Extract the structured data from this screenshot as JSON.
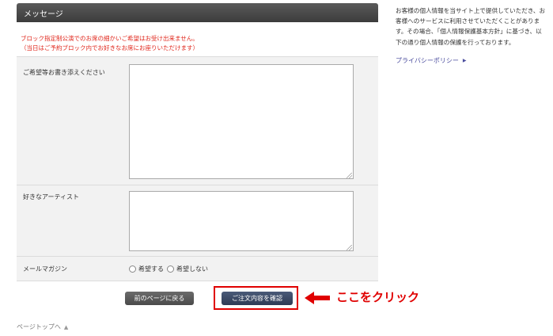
{
  "message_section": {
    "title": "メッセージ",
    "notice_line1": "ブロック指定制公演でのお席の細かいご希望はお受け出来ません。",
    "notice_line2": "（当日はご予約ブロック内でお好きなお席にお座りいただけます）"
  },
  "form": {
    "request_label": "ご希望等お書き添えください",
    "request_value": "",
    "artist_label": "好きなアーティスト",
    "artist_value": "",
    "newsletter_label": "メールマガジン",
    "newsletter_options": [
      "希望する",
      "希望しない"
    ],
    "newsletter_selected": null
  },
  "buttons": {
    "back_label": "前のページに戻る",
    "confirm_label": "ご注文内容を確認"
  },
  "annotation": {
    "click_here": "ここをクリック",
    "highlight_color": "#e00000"
  },
  "footer": {
    "page_top": "ページトップへ"
  },
  "sidebar": {
    "privacy_text": "お客様の個人情報を当サイト上で提供していただき、お客様へのサービスに利用させていただくことがあります。その場合、「個人情報保護基本方針」に基づき、以下の通り個人情報の保護を行っております。",
    "privacy_link": "プライバシーポリシー"
  },
  "colors": {
    "notice": "#e0261b",
    "link": "#4b4d9e",
    "row_bg": "#f2f2f2"
  }
}
